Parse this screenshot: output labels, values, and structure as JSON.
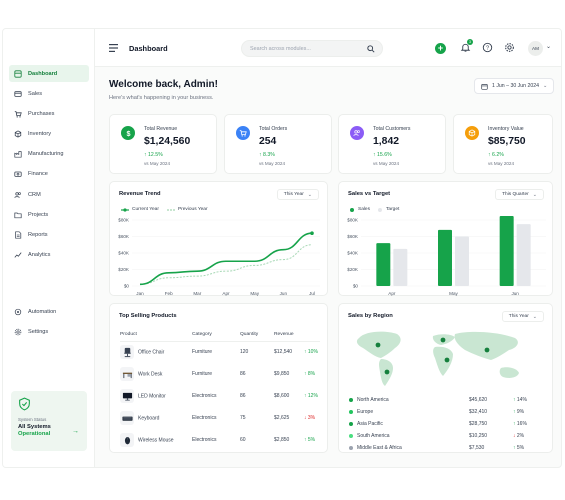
{
  "topbar": {
    "title": "Dashboard",
    "search_placeholder": "Search across modules...",
    "notification_count": "3",
    "avatar_initials": "AM"
  },
  "sidebar": {
    "items": [
      {
        "label": "Dashboard",
        "icon": "dashboard-icon",
        "active": true
      },
      {
        "label": "Sales",
        "icon": "sales-icon"
      },
      {
        "label": "Purchases",
        "icon": "cart-icon"
      },
      {
        "label": "Inventory",
        "icon": "box-icon"
      },
      {
        "label": "Manufacturing",
        "icon": "factory-icon"
      },
      {
        "label": "Finance",
        "icon": "finance-icon"
      },
      {
        "label": "CRM",
        "icon": "users-icon"
      },
      {
        "label": "Projects",
        "icon": "folder-icon"
      },
      {
        "label": "Reports",
        "icon": "report-icon"
      },
      {
        "label": "Analytics",
        "icon": "analytics-icon"
      }
    ],
    "bottom_items": [
      {
        "label": "Automation",
        "icon": "automation-icon"
      },
      {
        "label": "Settings",
        "icon": "gear-icon"
      }
    ],
    "status": {
      "label": "System Status",
      "title": "All Systems",
      "state": "Operational"
    }
  },
  "header": {
    "welcome": "Welcome back, Admin!",
    "subtitle": "Here's what's happening in your business.",
    "date_range": "1 Jun – 30 Jun 2024"
  },
  "kpis": [
    {
      "label": "Total Revenue",
      "value": "$1,24,560",
      "change": "12.5%",
      "vs": "vs May 2024",
      "icon": "dollar-icon",
      "color": "#16a34a",
      "bg": "#dcfce7"
    },
    {
      "label": "Total Orders",
      "value": "254",
      "change": "8.3%",
      "vs": "vs May 2024",
      "icon": "cart-icon",
      "color": "#3b82f6",
      "bg": "#dbeafe"
    },
    {
      "label": "Total Customers",
      "value": "1,842",
      "change": "15.6%",
      "vs": "vs May 2024",
      "icon": "users-icon",
      "color": "#8b5cf6",
      "bg": "#ede9fe"
    },
    {
      "label": "Inventory Value",
      "value": "$85,750",
      "change": "6.2%",
      "vs": "vs May 2024",
      "icon": "box-icon",
      "color": "#f59e0b",
      "bg": "#fef3c7"
    }
  ],
  "revenue_trend": {
    "title": "Revenue Trend",
    "filter": "This Year",
    "legend": [
      "Current Year",
      "Previous Year"
    ]
  },
  "sales_target": {
    "title": "Sales vs Target",
    "filter": "This Quarter",
    "legend": [
      "Sales",
      "Target"
    ]
  },
  "top_products": {
    "title": "Top Selling Products",
    "columns": [
      "Product",
      "Category",
      "Quantity",
      "Revenue"
    ],
    "rows": [
      {
        "product": "Office Chair",
        "category": "Furniture",
        "qty": "120",
        "revenue": "$12,540",
        "change": "10%",
        "dir": "up",
        "icon": "chair-icon"
      },
      {
        "product": "Work Desk",
        "category": "Furniture",
        "qty": "86",
        "revenue": "$9,850",
        "change": "8%",
        "dir": "up",
        "icon": "desk-icon"
      },
      {
        "product": "LED Monitor",
        "category": "Electronics",
        "qty": "86",
        "revenue": "$8,600",
        "change": "12%",
        "dir": "up",
        "icon": "monitor-icon"
      },
      {
        "product": "Keyboard",
        "category": "Electronics",
        "qty": "75",
        "revenue": "$2,625",
        "change": "3%",
        "dir": "down",
        "icon": "keyboard-icon"
      },
      {
        "product": "Wireless Mouse",
        "category": "Electronics",
        "qty": "60",
        "revenue": "$2,850",
        "change": "5%",
        "dir": "up",
        "icon": "mouse-icon"
      }
    ]
  },
  "sales_region": {
    "title": "Sales by Region",
    "filter": "This Year",
    "rows": [
      {
        "region": "North America",
        "value": "$45,620",
        "change": "14%",
        "dir": "up",
        "color": "#16a34a"
      },
      {
        "region": "Europe",
        "value": "$32,410",
        "change": "9%",
        "dir": "up",
        "color": "#22c55e"
      },
      {
        "region": "Asia Pacific",
        "value": "$28,750",
        "change": "16%",
        "dir": "up",
        "color": "#16a34a"
      },
      {
        "region": "South America",
        "value": "$10,250",
        "change": "2%",
        "dir": "down",
        "color": "#4ade80"
      },
      {
        "region": "Middle East & Africa",
        "value": "$7,530",
        "change": "5%",
        "dir": "up",
        "color": "#9ca3af"
      }
    ]
  },
  "chart_data": [
    {
      "type": "line",
      "title": "Revenue Trend",
      "categories": [
        "Jan",
        "Feb",
        "Mar",
        "Apr",
        "May",
        "Jun",
        "Jul"
      ],
      "ylim": [
        0,
        80000
      ],
      "y_ticks": [
        "$0",
        "$20K",
        "$40K",
        "$60K",
        "$80K"
      ],
      "series": [
        {
          "name": "Current Year",
          "values": [
            2000,
            16000,
            18000,
            30000,
            30000,
            44000,
            64000
          ],
          "color": "#16a34a"
        },
        {
          "name": "Previous Year",
          "values": [
            2000,
            10000,
            12000,
            18000,
            25000,
            32000,
            50000
          ],
          "color": "#a7d8b5"
        }
      ]
    },
    {
      "type": "bar",
      "title": "Sales vs Target",
      "categories": [
        "Apr",
        "May",
        "Jun"
      ],
      "ylim": [
        0,
        80000
      ],
      "y_ticks": [
        "$0",
        "$20K",
        "$40K",
        "$60K",
        "$80K"
      ],
      "series": [
        {
          "name": "Sales",
          "values": [
            52000,
            68000,
            85000
          ],
          "color": "#16a34a"
        },
        {
          "name": "Target",
          "values": [
            45000,
            60000,
            75000
          ],
          "color": "#e5e7eb"
        }
      ]
    }
  ]
}
